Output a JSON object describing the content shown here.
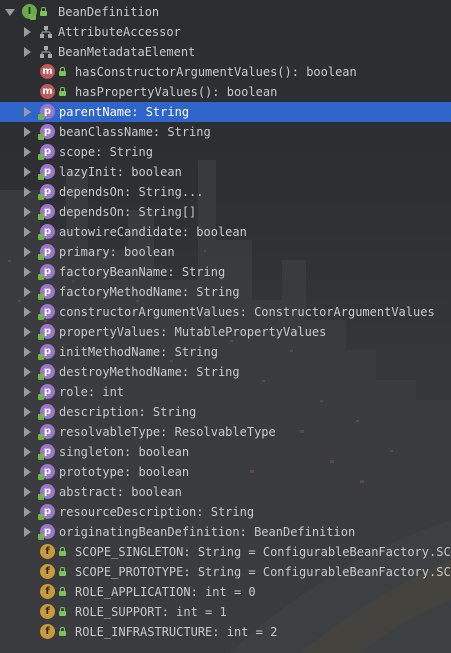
{
  "root": {
    "label": "BeanDefinition",
    "icon": "interface-icon",
    "icon_letter": "I"
  },
  "supertypes": [
    {
      "label": "AttributeAccessor",
      "icon": "hierarchy-icon"
    },
    {
      "label": "BeanMetadataElement",
      "icon": "hierarchy-icon"
    }
  ],
  "methods": [
    {
      "label": "hasConstructorArgumentValues(): boolean",
      "icon_letter": "m"
    },
    {
      "label": "hasPropertyValues(): boolean",
      "icon_letter": "m"
    }
  ],
  "properties": [
    {
      "label": "parentName: String",
      "icon_letter": "p",
      "selected": true
    },
    {
      "label": "beanClassName: String",
      "icon_letter": "p"
    },
    {
      "label": "scope: String",
      "icon_letter": "p"
    },
    {
      "label": "lazyInit: boolean",
      "icon_letter": "p"
    },
    {
      "label": "dependsOn: String...",
      "icon_letter": "p"
    },
    {
      "label": "dependsOn: String[]",
      "icon_letter": "p"
    },
    {
      "label": "autowireCandidate: boolean",
      "icon_letter": "p"
    },
    {
      "label": "primary: boolean",
      "icon_letter": "p"
    },
    {
      "label": "factoryBeanName: String",
      "icon_letter": "p"
    },
    {
      "label": "factoryMethodName: String",
      "icon_letter": "p"
    },
    {
      "label": "constructorArgumentValues: ConstructorArgumentValues",
      "icon_letter": "p"
    },
    {
      "label": "propertyValues: MutablePropertyValues",
      "icon_letter": "p"
    },
    {
      "label": "initMethodName: String",
      "icon_letter": "p"
    },
    {
      "label": "destroyMethodName: String",
      "icon_letter": "p"
    },
    {
      "label": "role: int",
      "icon_letter": "p"
    },
    {
      "label": "description: String",
      "icon_letter": "p"
    },
    {
      "label": "resolvableType: ResolvableType",
      "icon_letter": "p"
    },
    {
      "label": "singleton: boolean",
      "icon_letter": "p"
    },
    {
      "label": "prototype: boolean",
      "icon_letter": "p"
    },
    {
      "label": "abstract: boolean",
      "icon_letter": "p"
    },
    {
      "label": "resourceDescription: String",
      "icon_letter": "p"
    },
    {
      "label": "originatingBeanDefinition: BeanDefinition",
      "icon_letter": "p"
    }
  ],
  "fields": [
    {
      "label": "SCOPE_SINGLETON: String = ConfigurableBeanFactory.SCO",
      "icon_letter": "f"
    },
    {
      "label": "SCOPE_PROTOTYPE: String = ConfigurableBeanFactory.SCO",
      "icon_letter": "f"
    },
    {
      "label": "ROLE_APPLICATION: int = 0",
      "icon_letter": "f"
    },
    {
      "label": "ROLE_SUPPORT: int = 1",
      "icon_letter": "f"
    },
    {
      "label": "ROLE_INFRASTRUCTURE: int = 2",
      "icon_letter": "f"
    }
  ],
  "colors": {
    "background": "#2b2d30",
    "selection": "#2f65ca",
    "text": "#c9c9c9",
    "property_icon": "#9b77c9",
    "method_icon": "#c05858",
    "field_icon": "#c99a3b",
    "interface_icon": "#6aaa4c",
    "visibility_public": "#7cc257"
  }
}
